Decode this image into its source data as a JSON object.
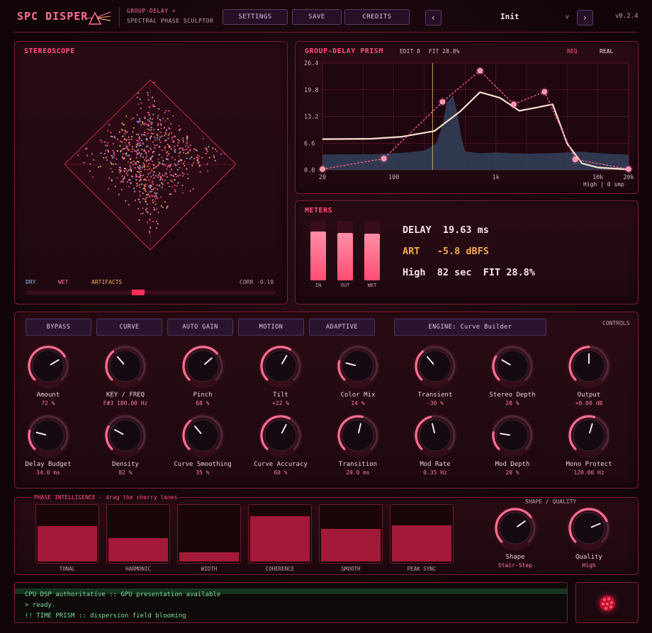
{
  "header": {
    "logo": "SPC DISPER",
    "subtitle_line1": "GROUP-DELAY +",
    "subtitle_line2": "SPECTRAL PHASE SCULPTOR",
    "buttons": {
      "settings": "SETTINGS",
      "save": "SAVE",
      "credits": "CREDITS"
    },
    "prev": "‹",
    "next": "›",
    "preset_name": "Init",
    "preset_caret": "v",
    "version": "v0.2.4"
  },
  "stereoscope": {
    "title": "STEREOSCOPE",
    "legend_dry": "DRY",
    "legend_wet": "WET",
    "legend_artifacts": "ARTIFACTS",
    "corr": "CORR -0.10",
    "corr_value": -0.1
  },
  "prism": {
    "title": "GROUP-DELAY PRISM",
    "edit": "EDIT 8",
    "fit": "FIT 28.8%",
    "req": "REQ",
    "real": "REAL",
    "footer": "High | 0 smp",
    "y_ticks": [
      "26.4",
      "19.8",
      "13.2",
      "6.6",
      "0.0"
    ],
    "x_ticks": [
      "20",
      "100",
      "1k",
      "10k",
      "20k"
    ],
    "colors": {
      "req": "#ff5c86",
      "real": "#f6e0cf",
      "spectrum": "#34415a",
      "cursor": "#c9a35a"
    }
  },
  "chart_data": {
    "type": "line",
    "title": "GROUP-DELAY PRISM",
    "x_scale": "log",
    "xlim": [
      20,
      20000
    ],
    "ylim": [
      0,
      26.4
    ],
    "series": [
      {
        "name": "REQ",
        "x": [
          20,
          80,
          300,
          700,
          1500,
          3000,
          6000,
          20000
        ],
        "y": [
          0.2,
          2.8,
          16.8,
          24.5,
          16.2,
          19.3,
          2.6,
          0.2
        ]
      },
      {
        "name": "REAL",
        "x": [
          20,
          60,
          120,
          250,
          450,
          700,
          1100,
          1700,
          2500,
          3600,
          5000,
          7000,
          10000,
          20000
        ],
        "y": [
          7.6,
          7.7,
          8.2,
          9.6,
          14.5,
          19.2,
          17.8,
          14.6,
          15.4,
          16.2,
          6.5,
          1.6,
          0.6,
          0.1
        ]
      }
    ],
    "cursor_x": 240
  },
  "meters": {
    "title": "METERS",
    "bars": [
      {
        "label": "IN",
        "level": 0.82
      },
      {
        "label": "OUT",
        "level": 0.8
      },
      {
        "label": "WET",
        "level": 0.79
      }
    ],
    "delay": "DELAY  19.63 ms",
    "art": "ART   -5.8 dBFS",
    "high": "High  82 sec  FIT 28.8%"
  },
  "controls": {
    "title": "CONTROLS",
    "buttons": [
      "BYPASS",
      "CURVE",
      "AUTO GAIN",
      "MOTION",
      "ADAPTIVE"
    ],
    "engine": "ENGINE:  Curve Builder",
    "knobs_row1": [
      {
        "label": "Amount",
        "value": "72 %",
        "pos": 0.72
      },
      {
        "label": "KEY / FREQ",
        "value": "F#3  180.00 Hz",
        "pos": 0.35
      },
      {
        "label": "Pinch",
        "value": "68 %",
        "pos": 0.68
      },
      {
        "label": "Tilt",
        "value": "+22 %",
        "pos": 0.61
      },
      {
        "label": "Color Mix",
        "value": "14 %",
        "pos": 0.22
      },
      {
        "label": "Transient",
        "value": "-30 %",
        "pos": 0.35
      },
      {
        "label": "Stereo Depth",
        "value": "28 %",
        "pos": 0.28
      },
      {
        "label": "Output",
        "value": "+0.00 dB",
        "pos": 0.5
      }
    ],
    "knobs_row2": [
      {
        "label": "Delay Budget",
        "value": "34.0 ms",
        "pos": 0.22
      },
      {
        "label": "Density",
        "value": "82 %",
        "pos": 0.27
      },
      {
        "label": "Curve Smoothing",
        "value": "35 %",
        "pos": 0.35
      },
      {
        "label": "Curve Accuracy",
        "value": "60 %",
        "pos": 0.6
      },
      {
        "label": "Transition",
        "value": "20.0 ms",
        "pos": 0.55
      },
      {
        "label": "Mod Rate",
        "value": "0.35 Hz",
        "pos": 0.45
      },
      {
        "label": "Mod Depth",
        "value": "20 %",
        "pos": 0.2
      },
      {
        "label": "Mono Protect",
        "value": "120.00 Hz",
        "pos": 0.56
      }
    ]
  },
  "phase": {
    "title": "PHASE INTELLIGENCE - drag the cherry lanes",
    "lanes": [
      {
        "label": "TONAL",
        "level": 0.62
      },
      {
        "label": "HARMONIC",
        "level": 0.41
      },
      {
        "label": "WIDTH",
        "level": 0.16
      },
      {
        "label": "COHERENCE",
        "level": 0.8
      },
      {
        "label": "SMOOTH",
        "level": 0.57
      },
      {
        "label": "PEAK SYNC",
        "level": 0.64
      }
    ],
    "shape_title": "SHAPE / QUALITY",
    "shape": {
      "label": "Shape",
      "value": "Stair-Step",
      "pos": 0.7
    },
    "quality": {
      "label": "Quality",
      "value": "High",
      "pos": 0.75
    }
  },
  "console": {
    "lines": [
      "CPU DSP authoritative :: GPU presentation available",
      "> ready.",
      "!! TIME PRISM :: dispersion field blooming"
    ]
  }
}
